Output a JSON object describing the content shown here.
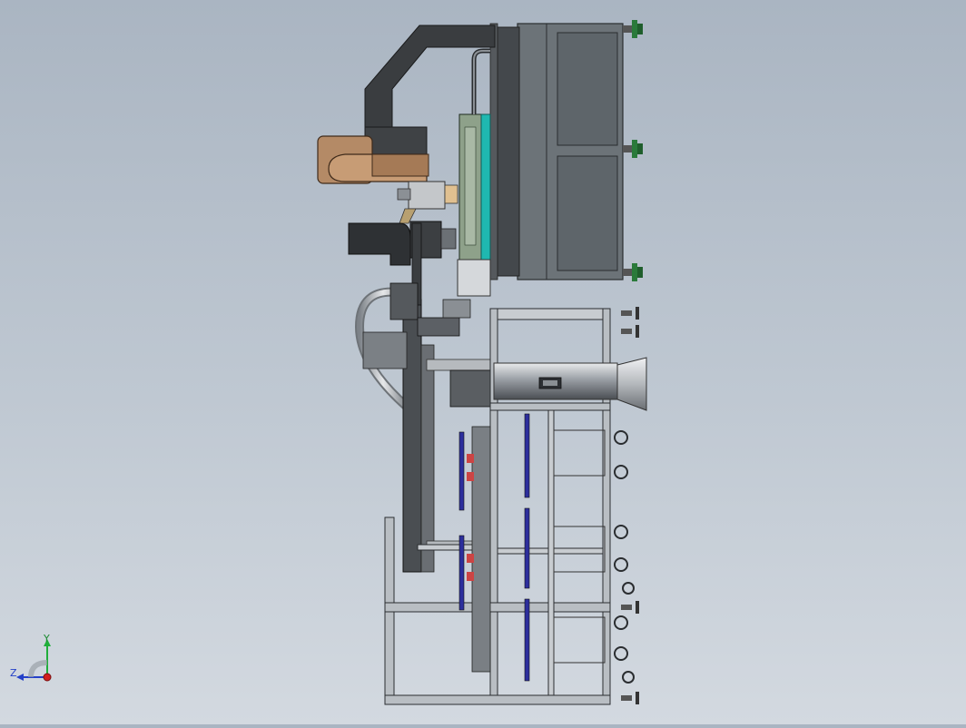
{
  "viewport": {
    "background_top": "#aab5c2",
    "background_bottom": "#d3d9e0"
  },
  "triad": {
    "y_label": "Y",
    "z_label": "Z",
    "y_color": "#1fae3a",
    "z_color": "#2440c8",
    "x_color": "#d21e1e"
  },
  "model": {
    "frame_color": "#9aa1a8",
    "dark_steel": "#3a3d40",
    "cabinet_color": "#6c7378",
    "teal_accent": "#1fb8b0",
    "blue_accent": "#2c2e9c",
    "wood_color": "#b48a66",
    "hopper_color": "#c9ccd0"
  }
}
